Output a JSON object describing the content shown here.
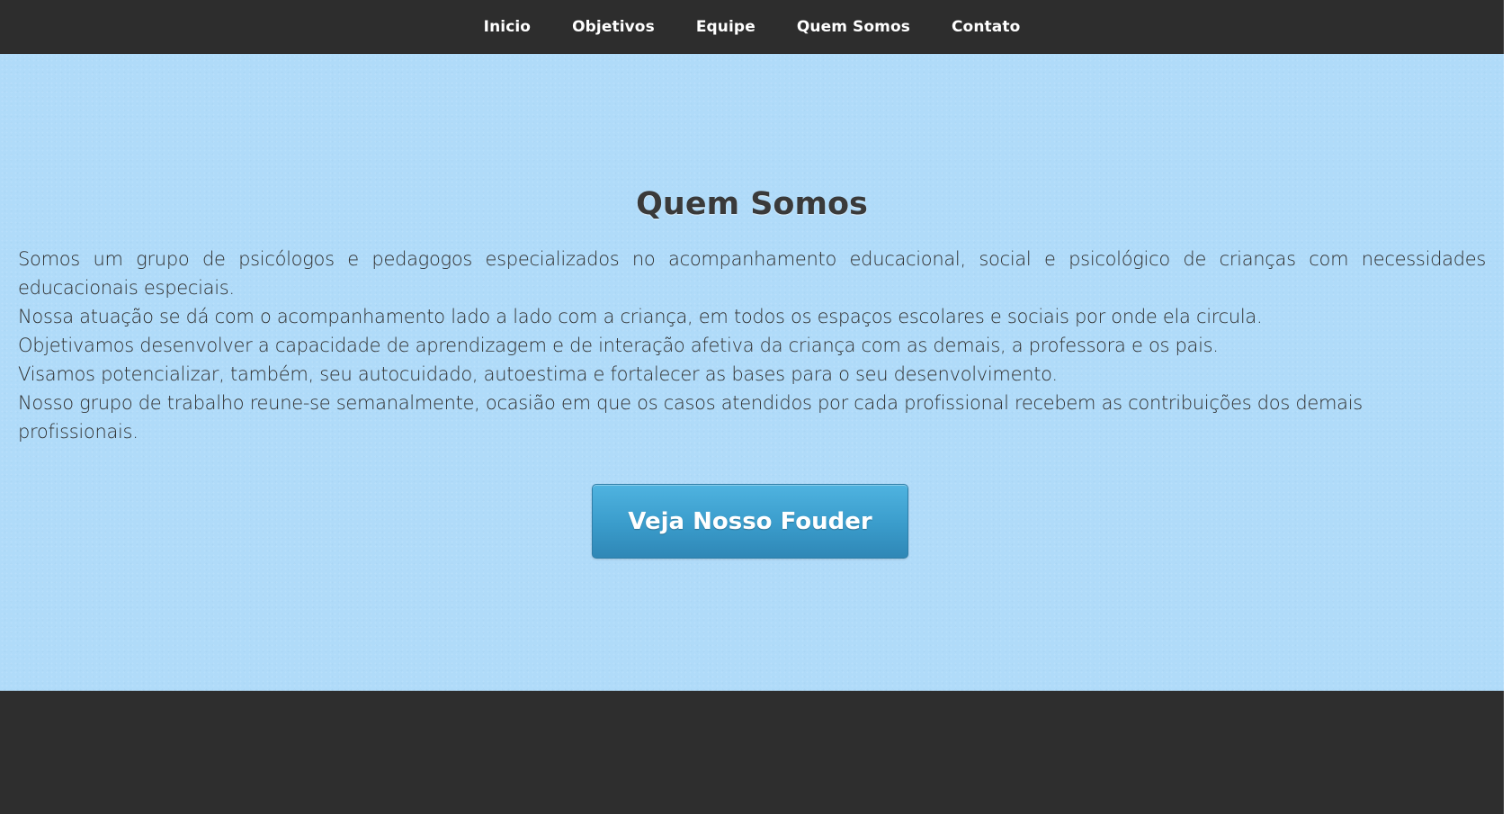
{
  "nav": {
    "items": [
      {
        "label": "Inicio"
      },
      {
        "label": "Objetivos"
      },
      {
        "label": "Equipe"
      },
      {
        "label": "Quem Somos"
      },
      {
        "label": "Contato"
      }
    ]
  },
  "about": {
    "title": "Quem Somos",
    "paragraphs": [
      "Somos um grupo de psicólogos e pedagogos especializados no acompanhamento educacional, social e psicológico de crianças com necessidades educacionais especiais.",
      "Nossa atuação se dá com o acompanhamento lado a lado com a criança, em todos os espaços escolares e sociais por onde ela circula.",
      "Objetivamos desenvolver a capacidade de aprendizagem e de interação afetiva da criança com as demais, a professora e os pais.",
      "Visamos potencializar, também, seu autocuidado, autoestima e fortalecer as bases para o seu desenvolvimento.",
      "Nosso grupo de trabalho reune-se semanalmente, ocasião em que os casos atendidos por cada profissional recebem as contribuições dos demais profissionais."
    ],
    "cta_label": "Veja Nosso Fouder"
  },
  "colors": {
    "nav_background": "#2d2d2d",
    "section_background": "#b0dbf9",
    "button_background": "#3a9ccb",
    "footer_background": "#2e2e2e"
  }
}
